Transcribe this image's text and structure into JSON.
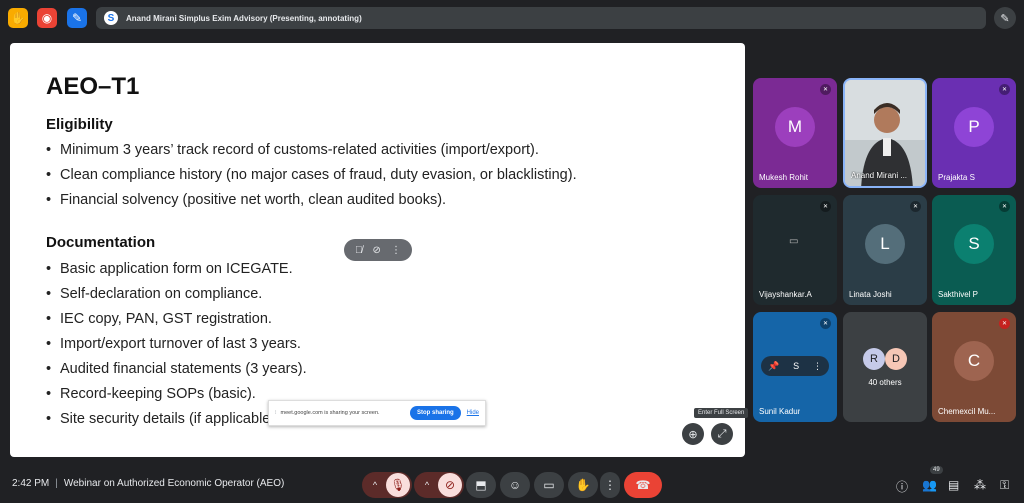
{
  "top": {
    "presenting_text": "Anand Mirani Simplus Exim Advisory (Presenting, annotating)",
    "colors": {
      "icon1": "#f9ab00",
      "icon2": "#ea4335",
      "icon3": "#1a73e8"
    }
  },
  "slide": {
    "title": "AEO–T1",
    "eligibility": {
      "heading": "Eligibility",
      "items": [
        "Minimum 3 years’ track record of customs-related activities (import/export).",
        "Clean compliance history (no major cases of fraud, duty evasion, or blacklisting).",
        "Financial solvency (positive net worth, clean audited books)."
      ]
    },
    "documentation": {
      "heading": "Documentation",
      "items": [
        "Basic application form on ICEGATE.",
        "Self-declaration on compliance.",
        "IEC copy, PAN, GST registration.",
        "Import/export turnover of last 3 years.",
        "Audited financial statements (3 years).",
        "Record-keeping SOPs (basic).",
        "Site security details (if applicable)."
      ]
    }
  },
  "share_bar": {
    "text": "meet.google.com is sharing your screen.",
    "stop_label": "Stop sharing",
    "hide_label": "Hide"
  },
  "tooltip": "Enter Full Screen",
  "participants": [
    {
      "name": "Mukesh Rohit",
      "initial": "M",
      "bg": "#7b2a94",
      "av": "#9c3fbd"
    },
    {
      "name": "Anand Mirani ...",
      "initial": "",
      "bg": "#cfd6d9",
      "av": ""
    },
    {
      "name": "Prajakta S",
      "initial": "P",
      "bg": "#6a2fb2",
      "av": "#8e44d6"
    },
    {
      "name": "Vijayshankar.A",
      "initial": "",
      "bg": "#1f2a2e",
      "av": ""
    },
    {
      "name": "Linata Joshi",
      "initial": "L",
      "bg": "#2b3d47",
      "av": "#546e7a"
    },
    {
      "name": "Sakthivel P",
      "initial": "S",
      "bg": "#0a5c52",
      "av": "#0b8070"
    },
    {
      "name": "Sunil Kadur",
      "initial": "",
      "bg": "#1565a8",
      "av": ""
    },
    {
      "name": "40 others",
      "initial": "",
      "bg": "#3c4043",
      "av": ""
    },
    {
      "name": "Chemexcil Mu...",
      "initial": "C",
      "bg": "#7d4a36",
      "av": "#9e6450"
    }
  ],
  "others": {
    "a": "R",
    "b": "D",
    "label": "40 others"
  },
  "bottom": {
    "time": "2:42 PM",
    "meeting_title": "Webinar on Authorized Economic Operator (AEO)",
    "participant_count": "49"
  }
}
